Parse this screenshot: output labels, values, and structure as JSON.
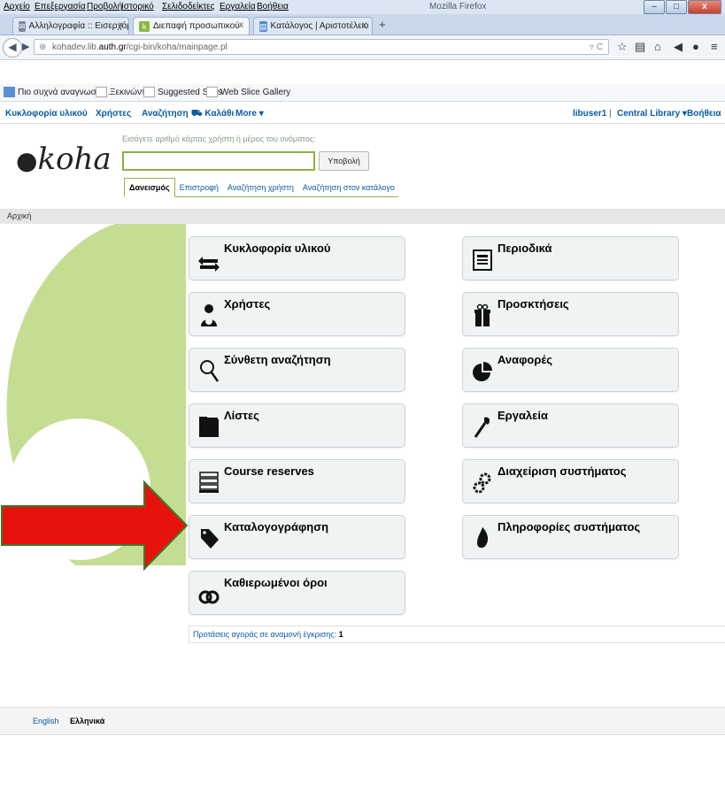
{
  "browser": {
    "menu": [
      "Αρχείο",
      "Επεξεργασία",
      "Προβολή",
      "Ιστορικό",
      "Σελιδοδείκτες",
      "Εργαλεία",
      "Βοήθεια"
    ],
    "window_title": "Mozilla Firefox",
    "tabs": [
      {
        "label": "Αλληλογραφία :: Εισερχόμ...",
        "active": false
      },
      {
        "label": "Διεπαφή προσωπικού",
        "active": true
      },
      {
        "label": "Κατάλογος | Αριστοτέλειο ...",
        "active": false
      }
    ],
    "new_tab": "+",
    "url_prefix": "kohadev.lib.",
    "url_bold": "auth.gr",
    "url_suffix": "/cgi-bin/koha/mainpage.pl",
    "bookmarks": [
      "Πιο συχνά αναγνωσμέ...",
      "Ξεκινώντας",
      "Suggested Sites",
      "Web Slice Gallery"
    ]
  },
  "koha_nav": {
    "left": [
      "Κυκλοφορία υλικού",
      "Χρήστες",
      "Αναζήτηση",
      "Καλάθι",
      "More"
    ],
    "user": "libuser1",
    "branch": "Central Library",
    "help": "Βοήθεια"
  },
  "logo": "koha",
  "search": {
    "hint": "Εισάγετε αριθμό κάρτας χρήστη ή μέρος του ονόματος:",
    "value": "",
    "submit": "Υποβολή",
    "tabs": [
      "Δανεισμός",
      "Επιστροφή",
      "Αναζήτηση χρήστη",
      "Αναζήτηση στον κατάλογο"
    ]
  },
  "breadcrumb": "Αρχική",
  "tiles_left": [
    {
      "label": "Κυκλοφορία υλικού",
      "icon": "circulation-icon"
    },
    {
      "label": "Χρήστες",
      "icon": "patrons-icon"
    },
    {
      "label": "Σύνθετη αναζήτηση",
      "icon": "search-icon"
    },
    {
      "label": "Λίστες",
      "icon": "lists-icon"
    },
    {
      "label": "Course reserves",
      "icon": "course-reserves-icon"
    },
    {
      "label": "Καταλογογράφηση",
      "icon": "cataloging-tag-icon"
    },
    {
      "label": "Καθιερωμένοι όροι",
      "icon": "authorities-icon"
    }
  ],
  "tiles_right": [
    {
      "label": "Περιοδικά",
      "icon": "serials-icon"
    },
    {
      "label": "Προσκτήσεις",
      "icon": "acquisitions-icon"
    },
    {
      "label": "Αναφορές",
      "icon": "reports-icon"
    },
    {
      "label": "Εργαλεία",
      "icon": "tools-icon"
    },
    {
      "label": "Διαχείριση συστήματος",
      "icon": "admin-gears-icon"
    },
    {
      "label": "Πληροφορίες συστήματος",
      "icon": "about-icon"
    }
  ],
  "pending": {
    "text": "Προτάσεις αγοράς σε αναμονή έγκρισης:",
    "count": "1"
  },
  "footer": {
    "lang1": "English",
    "lang2": "Ελληνικά"
  },
  "colors": {
    "accent_green": "#87b341",
    "link_blue": "#0a5aa5",
    "arrow_red": "#e8120c"
  }
}
